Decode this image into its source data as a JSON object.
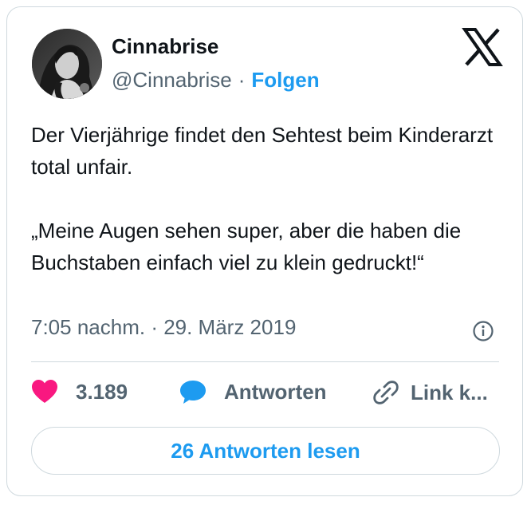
{
  "author": {
    "name": "Cinnabrise",
    "handle": "@Cinnabrise",
    "separator": "·",
    "follow_label": "Folgen"
  },
  "tweet": {
    "paragraphs": [
      "Der Vierjährige findet den Sehtest beim Kinderarzt total unfair.",
      "„Meine Augen sehen super, aber die haben die Buchstaben einfach viel zu klein gedruckt!“"
    ],
    "timestamp": "7:05 nachm. · 29. März 2019"
  },
  "actions": {
    "likes": "3.189",
    "reply_label": "Antworten",
    "link_label": "Link k..."
  },
  "read_replies_label": "26 Antworten lesen",
  "icons": {
    "logo": "x-logo-icon",
    "info": "info-icon",
    "like": "heart-icon",
    "reply": "speech-bubble-icon",
    "link": "link-icon"
  },
  "colors": {
    "accent": "#1d9bf0",
    "like": "#f91880",
    "text": "#0f1419",
    "muted": "#536471",
    "border": "#cfd9de"
  }
}
